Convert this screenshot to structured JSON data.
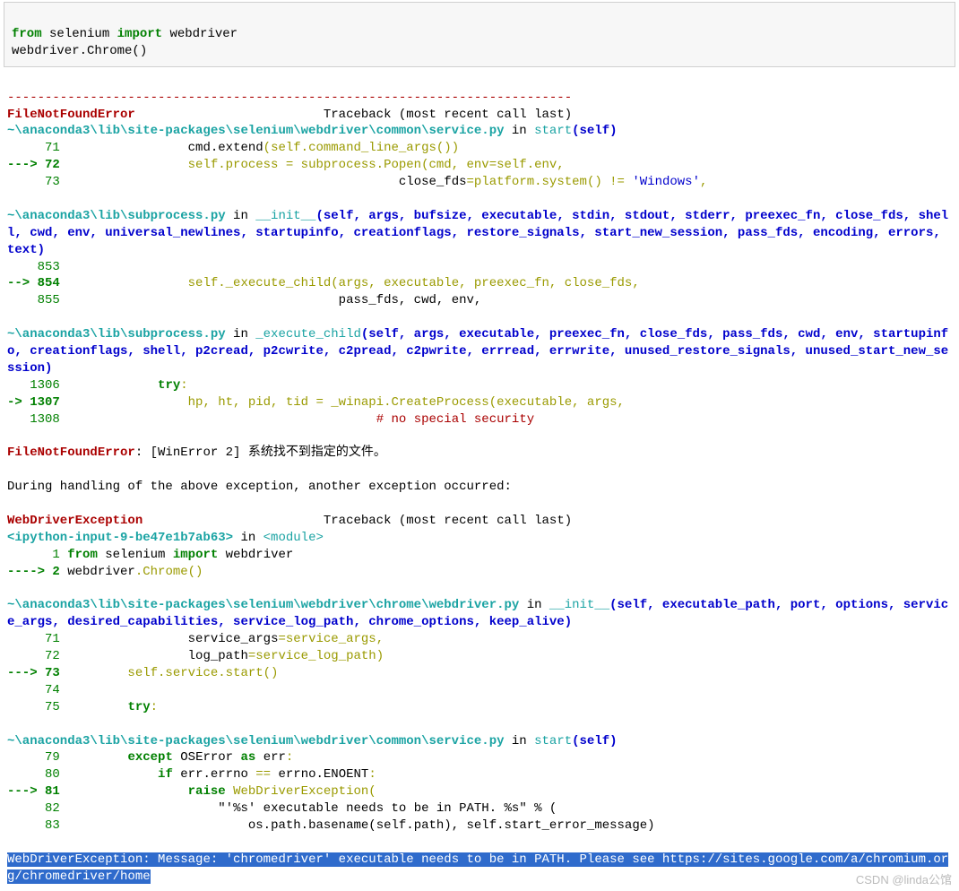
{
  "code_cell": {
    "line1_pre": "from ",
    "line1_mod": "selenium ",
    "line1_imp": "import ",
    "line1_obj": "webdriver",
    "line2_pre": "webdriver.Chrome",
    "line2_par": "()"
  },
  "tb": {
    "sep": "---------------------------------------------------------------------------",
    "err1_name": "FileNotFoundError",
    "err1_spacer": "                         ",
    "tb_label": "Traceback (most recent call last)",
    "f1_path": "~\\anaconda3\\lib\\site-packages\\selenium\\webdriver\\common\\service.py",
    "in_word": " in ",
    "f1_fn": "start",
    "self_arg": "(self)",
    "f1_l71_no": "     71 ",
    "f1_l71_txt": "                cmd.extend",
    "f1_l71_call": "(self.command_line_args",
    "f1_l71_par": "())",
    "f1_l72_arrow": "---> 72 ",
    "f1_l72_txt": "                self.process = subprocess.Popen(cmd, env=self.env,",
    "f1_l73_no": "     73 ",
    "f1_l73_lead": "                                            close_fds",
    "f1_l73_eq": "=platform.system",
    "f1_l73_call": "()",
    "f1_l73_ne": " != ",
    "f1_l73_str": "'Windows'",
    "f1_l73_end": ",",
    "f2_path": "~\\anaconda3\\lib\\subprocess.py",
    "f2_fn": "__init__",
    "f2_args": "(self, args, bufsize, executable, stdin, stdout, stderr, preexec_fn, close_fds, shell, cwd, env, universal_newlines, startupinfo, creationflags, restore_signals, start_new_session, pass_fds, encoding, errors, text)",
    "f2_l853_no": "    853 ",
    "f2_l854_arrow": "--> 854 ",
    "f2_l854_txt": "                self._execute_child(args, executable, preexec_fn, close_fds,",
    "f2_l855_no": "    855 ",
    "f2_l855_txt": "                                    pass_fds, cwd, env,",
    "f3_path": "~\\anaconda3\\lib\\subprocess.py",
    "f3_fn": "_execute_child",
    "f3_args": "(self, args, executable, preexec_fn, close_fds, pass_fds, cwd, env, startupinfo, creationflags, shell, p2cread, p2cwrite, c2pread, c2pwrite, errread, errwrite, unused_restore_signals, unused_start_new_session)",
    "f3_l1306_no": "   1306 ",
    "f3_l1306_kw": "            try",
    "f3_l1306_c": ":",
    "f3_l1307_arrow": "-> 1307 ",
    "f3_l1307_txt": "                hp, ht, pid, tid = _winapi.CreateProcess(executable, args,",
    "f3_l1308_no": "   1308 ",
    "f3_l1308_cmt": "                                         # no special security",
    "err1_line": ": [WinError 2] 系统找不到指定的文件。",
    "during": "During handling of the above exception, another exception occurred:",
    "err2_name": "WebDriverException",
    "err2_spacer": "                        ",
    "ipy_src": "<ipython-input-9-be47e1b7ab63>",
    "ipy_mod": "<module>",
    "ipy_l1_no": "      1 ",
    "ipy_l1_from": "from",
    "ipy_l1_sel": " selenium ",
    "ipy_l1_imp": "import",
    "ipy_l1_wd": " webdriver",
    "ipy_l2_arrow": "----> 2 ",
    "ipy_l2_pre": "webdriver",
    "ipy_l2_dot": ".Chrome",
    "ipy_l2_par": "()",
    "f4_path": "~\\anaconda3\\lib\\site-packages\\selenium\\webdriver\\chrome\\webdriver.py",
    "f4_fn": "__init__",
    "f4_args": "(self, executable_path, port, options, service_args, desired_capabilities, service_log_path, chrome_options, keep_alive)",
    "f4_l71_no": "     71 ",
    "f4_l71_txt": "                service_args",
    "f4_l71_eq": "=service_args,",
    "f4_l72_no": "     72 ",
    "f4_l72_txt": "                log_path",
    "f4_l72_eq": "=service_log_path)",
    "f4_l73_arrow": "---> 73 ",
    "f4_l73_txt": "        self.service.start",
    "f4_l73_par": "()",
    "f4_l74_no": "     74 ",
    "f4_l75_no": "     75 ",
    "f4_l75_kw": "        try",
    "f4_l75_c": ":",
    "f5_path": "~\\anaconda3\\lib\\site-packages\\selenium\\webdriver\\common\\service.py",
    "f5_fn": "start",
    "f5_l79_no": "     79 ",
    "f5_l79_kw1": "        except ",
    "f5_l79_cls": "OSError ",
    "f5_l79_kw2": "as ",
    "f5_l79_var": "err",
    "f5_l79_c": ":",
    "f5_l80_no": "     80 ",
    "f5_l80_kw": "            if ",
    "f5_l80_rest": "err.errno ",
    "f5_l80_eq": "== ",
    "f5_l80_val": "errno.ENOENT",
    "f5_l80_c": ":",
    "f5_l81_arrow": "---> 81 ",
    "f5_l81_kw": "                raise ",
    "f5_l81_exc": "WebDriverException(",
    "f5_l82_no": "     82 ",
    "f5_l82_str": "                    \"'%s' executable needs to be in PATH. %s\" % (",
    "f5_l83_no": "     83 ",
    "f5_l83_txt": "                        os.path.basename(self.path), self.start_error_message)",
    "final_err_name": "WebDriverException",
    "final_err_rest": ": Message: 'chromedriver' executable needs to be in PATH. Please see https://sites.google.com/a/chromium.org/chromedriver/home"
  },
  "watermark": "CSDN @linda公馆"
}
